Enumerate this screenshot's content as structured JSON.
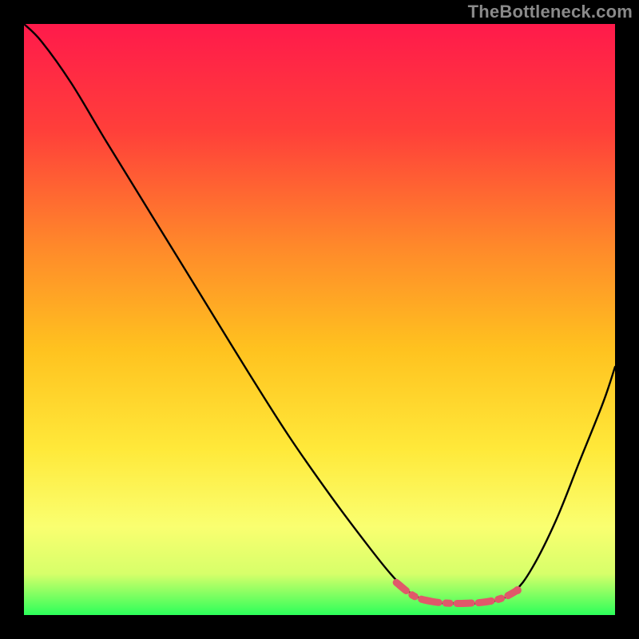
{
  "watermark": "TheBottleneck.com",
  "chart_data": {
    "type": "line",
    "title": "",
    "xlabel": "",
    "ylabel": "",
    "xlim": [
      0,
      100
    ],
    "ylim": [
      0,
      100
    ],
    "gradient_stops": [
      {
        "offset": 0,
        "color": "#ff1a4b"
      },
      {
        "offset": 18,
        "color": "#ff3f3a"
      },
      {
        "offset": 38,
        "color": "#ff8a2a"
      },
      {
        "offset": 55,
        "color": "#ffc21f"
      },
      {
        "offset": 72,
        "color": "#ffe93a"
      },
      {
        "offset": 85,
        "color": "#faff70"
      },
      {
        "offset": 93,
        "color": "#d7ff6a"
      },
      {
        "offset": 100,
        "color": "#2cff5a"
      }
    ],
    "series": [
      {
        "name": "bottleneck-curve",
        "color": "#000000",
        "points": [
          {
            "x": 0,
            "y": 100
          },
          {
            "x": 3,
            "y": 97
          },
          {
            "x": 8,
            "y": 90
          },
          {
            "x": 14,
            "y": 80
          },
          {
            "x": 22,
            "y": 67
          },
          {
            "x": 30,
            "y": 54
          },
          {
            "x": 38,
            "y": 41
          },
          {
            "x": 45,
            "y": 30
          },
          {
            "x": 52,
            "y": 20
          },
          {
            "x": 58,
            "y": 12
          },
          {
            "x": 62,
            "y": 7
          },
          {
            "x": 65,
            "y": 4
          },
          {
            "x": 68,
            "y": 2.5
          },
          {
            "x": 71,
            "y": 2
          },
          {
            "x": 74,
            "y": 2
          },
          {
            "x": 77,
            "y": 2
          },
          {
            "x": 80,
            "y": 2.5
          },
          {
            "x": 83,
            "y": 4
          },
          {
            "x": 86,
            "y": 8
          },
          {
            "x": 90,
            "y": 16
          },
          {
            "x": 94,
            "y": 26
          },
          {
            "x": 98,
            "y": 36
          },
          {
            "x": 100,
            "y": 42
          }
        ]
      },
      {
        "name": "valley-highlight",
        "color": "#e0596a",
        "stroke_width": 9,
        "dasharray": "16 9 4 9 22 9 5 9 18 9",
        "points": [
          {
            "x": 63,
            "y": 5.5
          },
          {
            "x": 66,
            "y": 3.2
          },
          {
            "x": 69,
            "y": 2.3
          },
          {
            "x": 72,
            "y": 2.0
          },
          {
            "x": 75,
            "y": 2.0
          },
          {
            "x": 78,
            "y": 2.2
          },
          {
            "x": 81,
            "y": 2.9
          },
          {
            "x": 83.5,
            "y": 4.2
          }
        ]
      }
    ]
  }
}
